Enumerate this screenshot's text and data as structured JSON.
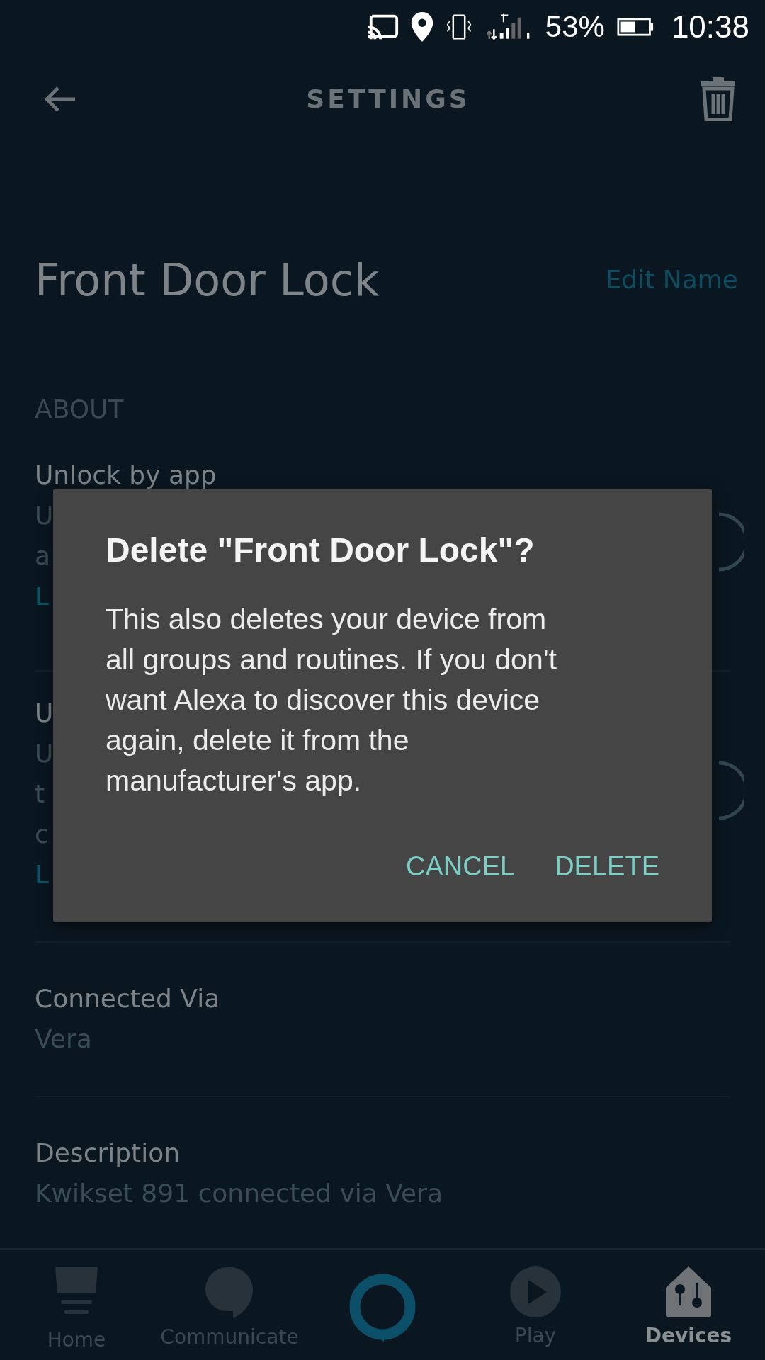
{
  "status_bar": {
    "battery": "53%",
    "time": "10:38"
  },
  "header": {
    "title": "SETTINGS"
  },
  "device": {
    "name": "Front Door Lock",
    "edit_link": "Edit Name"
  },
  "section": "ABOUT",
  "partial_rows": [
    {
      "title": "Unlock by app",
      "lines": [
        "U",
        "a"
      ],
      "link": "L",
      "on": false
    },
    {
      "title": "U",
      "lines": [
        "U",
        "t",
        "c"
      ],
      "link": "L",
      "on": false
    }
  ],
  "rows": [
    {
      "title": "Connected Via",
      "value": "Vera"
    },
    {
      "title": "Description",
      "value": "Kwikset 891 connected via Vera"
    }
  ],
  "dialog": {
    "title": "Delete \"Front Door Lock\"?",
    "message": "This also deletes your device from all groups and routines. If you don't want Alexa to discover this device again, delete it from the manufacturer's app.",
    "buttons": [
      "CANCEL",
      "DELETE"
    ]
  },
  "nav": [
    {
      "kind": "home",
      "label": "Home",
      "selected": false
    },
    {
      "kind": "chat",
      "label": "Communicate",
      "selected": false
    },
    {
      "kind": "alexa",
      "selected": false
    },
    {
      "kind": "play",
      "label": "Play",
      "selected": false
    },
    {
      "kind": "devices",
      "label": "Devices",
      "selected": true
    }
  ]
}
